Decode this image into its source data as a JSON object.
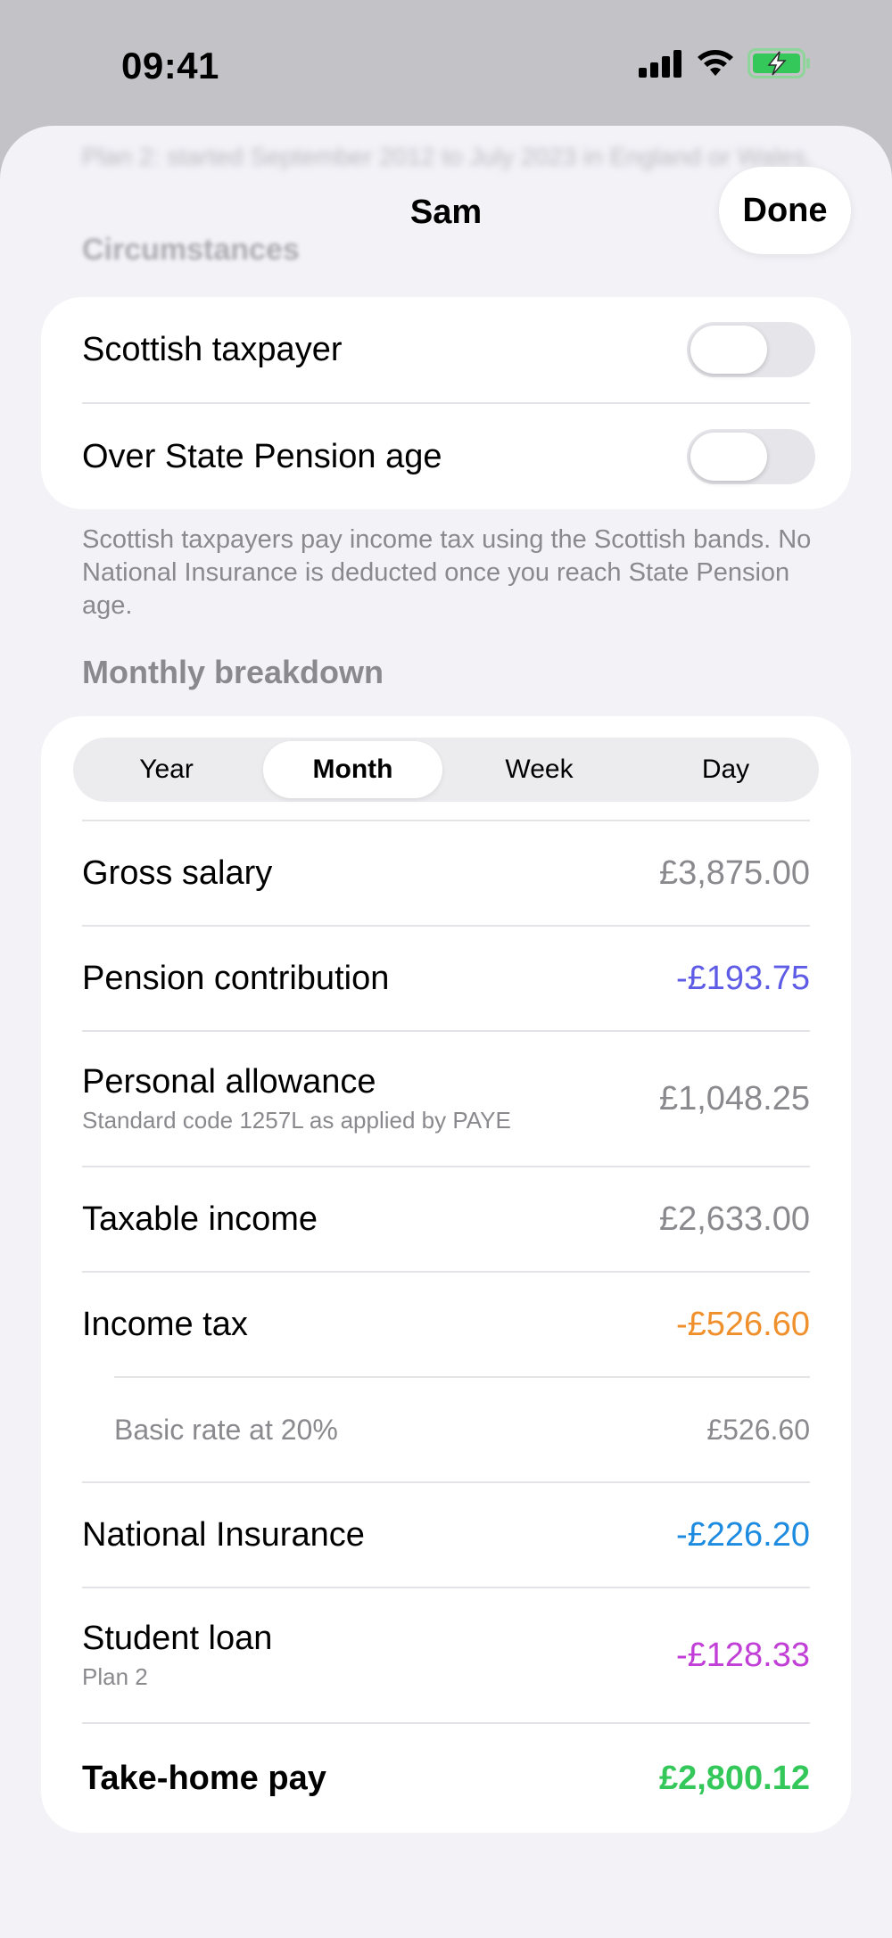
{
  "status_bar": {
    "time": "09:41"
  },
  "sheet": {
    "background_text": "Plan 2: started September 2012 to July 2023 in England or Wales.",
    "background_header": "Circumstances",
    "title": "Sam",
    "done_label": "Done"
  },
  "circumstances": {
    "rows": [
      {
        "label": "Scottish taxpayer",
        "on": false
      },
      {
        "label": "Over State Pension age",
        "on": false
      }
    ],
    "footnote": "Scottish taxpayers pay income tax using the Scottish bands. No National Insurance is deducted once you reach State Pension age."
  },
  "breakdown": {
    "header": "Monthly breakdown",
    "periods": [
      "Year",
      "Month",
      "Week",
      "Day"
    ],
    "selected_period": "Month",
    "rows": [
      {
        "label": "Gross salary",
        "sub": "",
        "value": "£3,875.00",
        "color": "#8a8a8e"
      },
      {
        "label": "Pension contribution",
        "sub": "",
        "value": "-£193.75",
        "color": "#5e5ce6"
      },
      {
        "label": "Personal allowance",
        "sub": "Standard code 1257L as applied by PAYE",
        "value": "£1,048.25",
        "color": "#8a8a8e"
      },
      {
        "label": "Taxable income",
        "sub": "",
        "value": "£2,633.00",
        "color": "#8a8a8e"
      },
      {
        "label": "Income tax",
        "sub": "",
        "value": "-£526.60",
        "color": "#f0902c"
      },
      {
        "label": "Basic rate at 20%",
        "sub": "",
        "value": "£526.60",
        "color": "#8a8a8e",
        "indent": true
      },
      {
        "label": "National Insurance",
        "sub": "",
        "value": "-£226.20",
        "color": "#1c8be0"
      },
      {
        "label": "Student loan",
        "sub": "Plan 2",
        "value": "-£128.33",
        "color": "#c13fd6"
      },
      {
        "label": "Take-home pay",
        "sub": "",
        "value": "£2,800.12",
        "color": "#34c759",
        "total": true
      }
    ]
  },
  "colors": {
    "sheet_bg": "#f2f2f7",
    "battery_green": "#34c759"
  },
  "icons": [
    "cellular-signal-icon",
    "wifi-icon",
    "battery-charging-icon"
  ]
}
